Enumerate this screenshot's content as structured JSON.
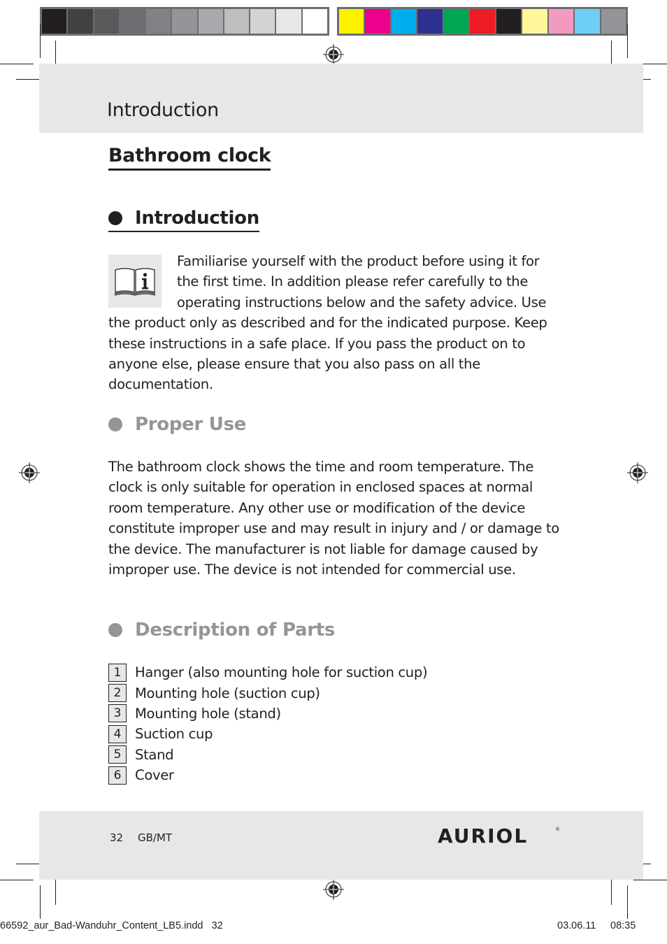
{
  "calibration": {
    "grayscale": [
      "#231f20",
      "#414042",
      "#58595b",
      "#6d6e71",
      "#808285",
      "#939598",
      "#a7a9ac",
      "#bcbec0",
      "#d1d3d4",
      "#e6e7e8",
      "#ffffff"
    ],
    "colors": [
      "#fff200",
      "#ec008c",
      "#00aeef",
      "#2e3192",
      "#00a651",
      "#ed1c24",
      "#231f20",
      "#fff799",
      "#f49ac1",
      "#6dcff6",
      "#939598"
    ]
  },
  "header": {
    "title": "Introduction"
  },
  "document": {
    "main_heading": "Bathroom clock",
    "sections": {
      "introduction": {
        "title": "Introduction",
        "icon": "manual-info-icon",
        "text": "Familiarise yourself with the product before using it for the first time. In addition please refer carefully to the operating instructions below and the safety advice. Use the product only as described and for the indicated purpose. Keep these instructions in a safe place. If you pass the product on to anyone else, please ensure that you also pass on all the documentation."
      },
      "proper_use": {
        "title": "Proper Use",
        "text": "The bathroom clock shows the time and room temperature. The clock is only suitable for operation in enclosed spaces at normal room temperature. Any other use or modification of the device constitute improper use and may result in injury and / or damage to the device. The manufacturer is not liable for damage caused by improper use. The device is not intended for commercial use."
      },
      "parts": {
        "title": "Description of Parts",
        "items": [
          {
            "num": "1",
            "label": "Hanger (also mounting hole for suction cup)"
          },
          {
            "num": "2",
            "label": "Mounting hole (suction cup)"
          },
          {
            "num": "3",
            "label": "Mounting hole (stand)"
          },
          {
            "num": "4",
            "label": "Suction cup"
          },
          {
            "num": "5",
            "label": "Stand"
          },
          {
            "num": "6",
            "label": "Cover"
          }
        ]
      }
    }
  },
  "footer": {
    "page_number": "32",
    "language": "GB/MT",
    "brand": "AURIOL",
    "brand_mark": "®"
  },
  "slug": {
    "filename": "66592_aur_Bad-Wanduhr_Content_LB5.indd   32",
    "date": "03.06.11",
    "time": "08:35"
  }
}
